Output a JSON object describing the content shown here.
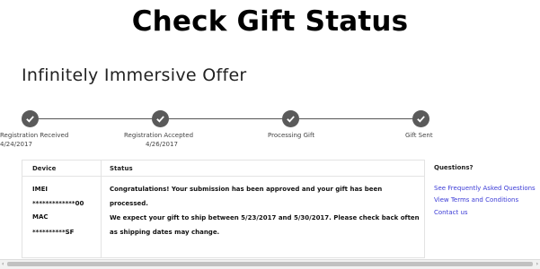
{
  "page": {
    "title": "Check Gift Status",
    "offer_title": "Infinitely Immersive Offer"
  },
  "progress": {
    "steps": [
      {
        "label": "Registration Received",
        "date": "4/24/2017",
        "status": "complete"
      },
      {
        "label": "Registration Accepted",
        "date": "4/26/2017",
        "status": "complete"
      },
      {
        "label": "Processing Gift",
        "date": "",
        "status": "complete"
      },
      {
        "label": "Gift Sent",
        "date": "",
        "status": "complete"
      }
    ],
    "dot_color": "#5a5a5a"
  },
  "table": {
    "headers": {
      "device": "Device",
      "status": "Status"
    },
    "device": {
      "imei_label": "IMEI",
      "imei_value": "*************00",
      "mac_label": "MAC",
      "mac_value": "**********SF"
    },
    "status_lines": [
      "Congratulations! Your submission has been approved and your gift has been",
      "processed.",
      "We expect your gift to ship between 5/23/2017 and 5/30/2017. Please check back often",
      "as shipping dates may change."
    ]
  },
  "questions": {
    "title": "Questions?",
    "links": [
      "See Frequently Asked Questions",
      "View Terms and Conditions",
      "Contact us"
    ],
    "link_color": "#3b3bd6"
  },
  "scrollbar": {
    "left_arrow": "‹",
    "right_arrow": "›"
  }
}
